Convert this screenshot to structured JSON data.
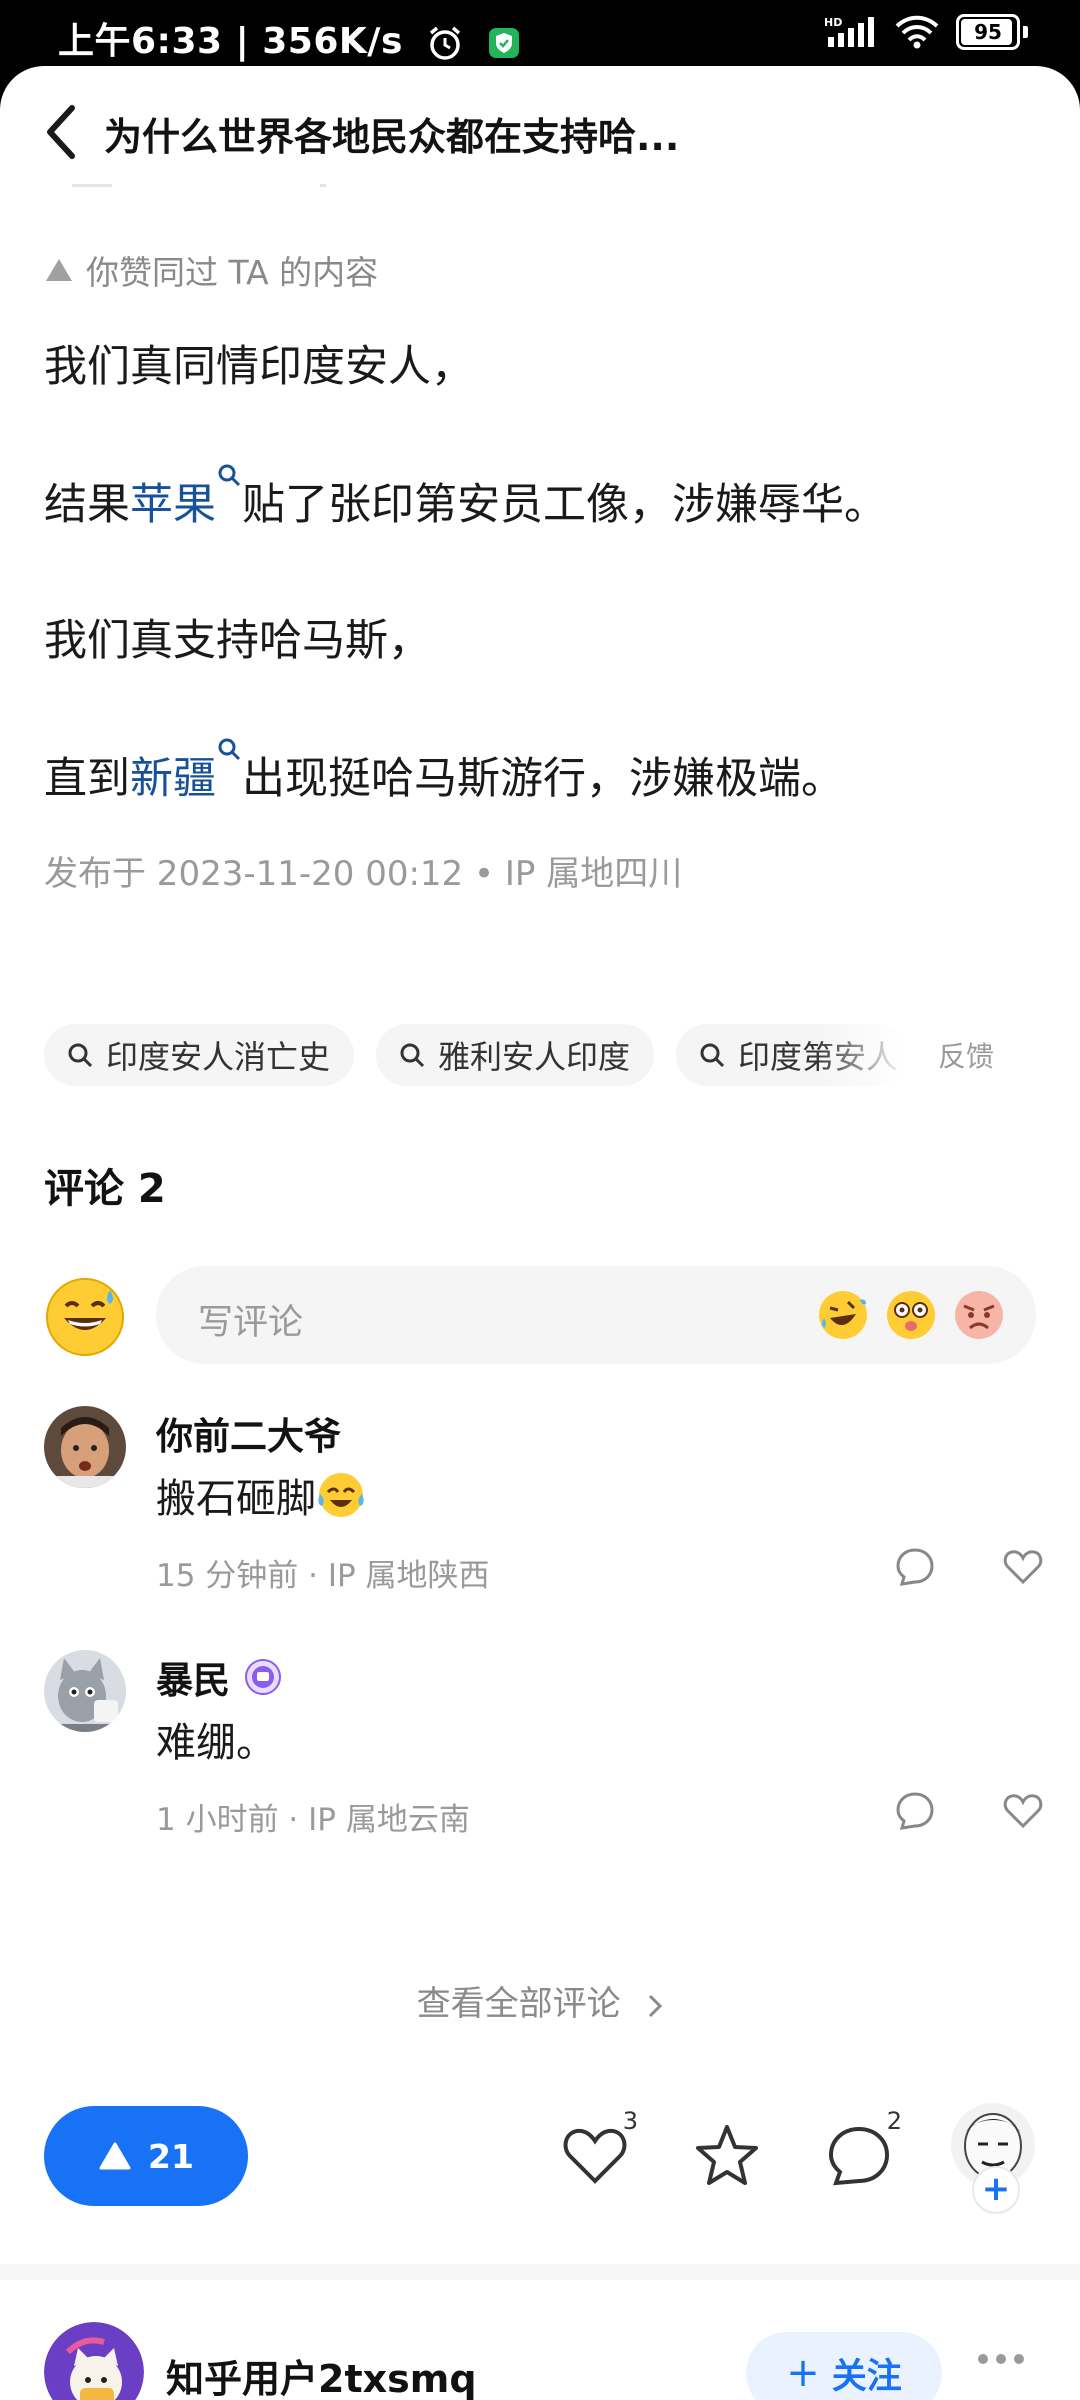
{
  "status": {
    "time_speed": "上午6:33 | 356K/s",
    "network": "HD",
    "battery": "95"
  },
  "header": {
    "title": "为什么世界各地民众都在支持哈..."
  },
  "answer": {
    "liked_notice": "你赞同过 TA 的内容",
    "line1": "我们真同情印度安人，",
    "line2_pre": "结果",
    "line2_link": "苹果",
    "line2_post": "贴了张印第安员工像，涉嫌辱华。",
    "line3": "我们真支持哈马斯，",
    "line4_pre": "直到",
    "line4_link": "新疆",
    "line4_post": "出现挺哈马斯游行，涉嫌极端。",
    "meta": "发布于 2023-11-20 00:12 • IP 属地四川"
  },
  "related": {
    "chips": [
      "印度安人消亡史",
      "雅利安人印度",
      "印度第安人"
    ],
    "feedback": "反馈"
  },
  "comments": {
    "title": "评论 2",
    "input_placeholder": "写评论",
    "items": [
      {
        "name": "你前二大爷",
        "text": "搬石砸脚",
        "meta": "15 分钟前 · IP 属地陕西"
      },
      {
        "name": "暴民",
        "text": "难绷。",
        "meta": "1 小时前 · IP 属地云南"
      }
    ],
    "view_all": "查看全部评论"
  },
  "actions": {
    "vote_count": "21",
    "like_count": "3",
    "comment_count": "2"
  },
  "next": {
    "name": "知乎用户2txsmq",
    "follow_label": "关注",
    "follow_plus": "+"
  },
  "colors": {
    "accent": "#1772f6",
    "link": "#175199"
  }
}
